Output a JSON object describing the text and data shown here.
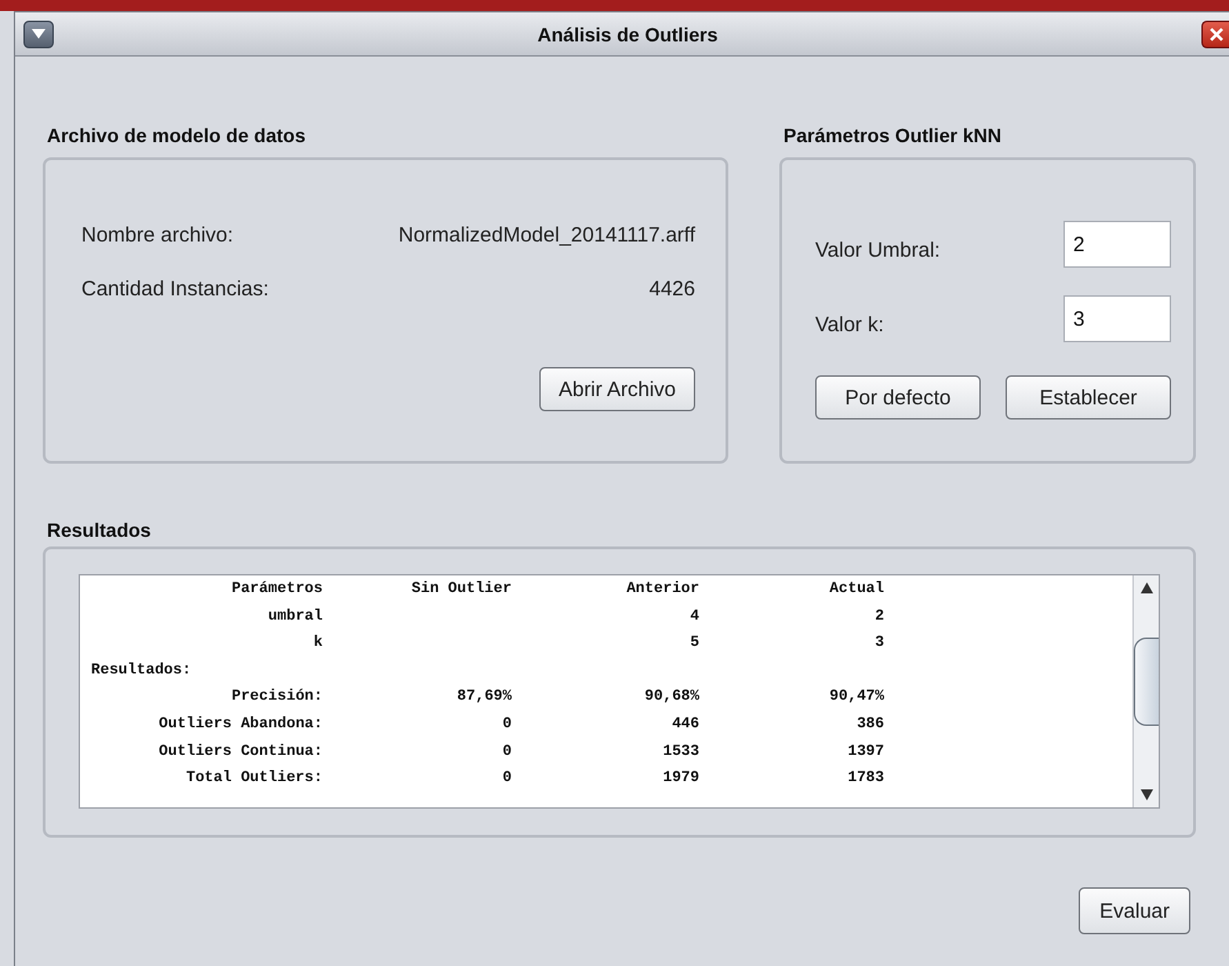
{
  "window": {
    "title": "Análisis de Outliers"
  },
  "file_panel": {
    "title": "Archivo de modelo de datos",
    "fields": [
      {
        "label": "Nombre archivo:",
        "value": "NormalizedModel_20141117.arff"
      },
      {
        "label": "Cantidad Instancias:",
        "value": "4426"
      }
    ],
    "button": "Abrir Archivo"
  },
  "params_panel": {
    "title": "Parámetros Outlier kNN",
    "fields": [
      {
        "label": "Valor Umbral:",
        "value": "2"
      },
      {
        "label": "Valor k:",
        "value": "3"
      }
    ],
    "buttons": [
      "Por defecto",
      "Establecer"
    ]
  },
  "results_panel": {
    "title": "Resultados",
    "rows": [
      {
        "kind": "data",
        "cells": [
          "Parámetros",
          "Sin Outlier",
          "Anterior",
          "Actual"
        ]
      },
      {
        "kind": "data",
        "cells": [
          "umbral",
          "",
          "4",
          "2"
        ]
      },
      {
        "kind": "data",
        "cells": [
          "k",
          "",
          "5",
          "3"
        ]
      },
      {
        "kind": "section",
        "cells": [
          "Resultados:"
        ]
      },
      {
        "kind": "data",
        "cells": [
          "Precisión:",
          "87,69%",
          "90,68%",
          "90,47%"
        ]
      },
      {
        "kind": "data",
        "cells": [
          "Outliers Abandona:",
          "0",
          "446",
          "386"
        ]
      },
      {
        "kind": "data",
        "cells": [
          "Outliers Continua:",
          "0",
          "1533",
          "1397"
        ]
      },
      {
        "kind": "data",
        "cells": [
          "Total Outliers:",
          "0",
          "1979",
          "1783"
        ]
      }
    ]
  },
  "footer": {
    "button": "Evaluar"
  }
}
